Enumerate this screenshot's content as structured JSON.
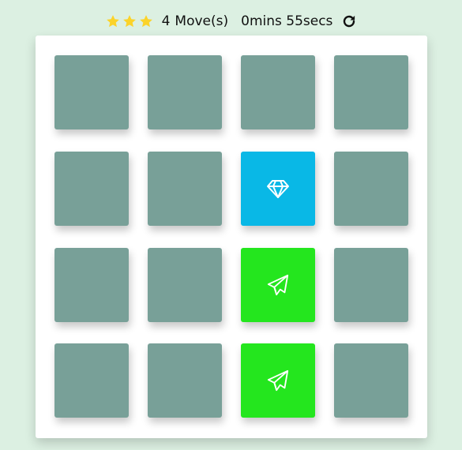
{
  "score_panel": {
    "stars": 3,
    "star_color": "#fbd32a",
    "moves_count": "4",
    "moves_label": "Move(s)",
    "time_text": "0mins 55secs",
    "restart_icon": "refresh-icon"
  },
  "colors": {
    "hidden": "#78a098",
    "open": "#09b8e6",
    "match": "#24e61e"
  },
  "board": {
    "rows": 4,
    "cols": 4,
    "cards": [
      {
        "state": "hidden",
        "icon": ""
      },
      {
        "state": "hidden",
        "icon": ""
      },
      {
        "state": "hidden",
        "icon": ""
      },
      {
        "state": "hidden",
        "icon": ""
      },
      {
        "state": "hidden",
        "icon": ""
      },
      {
        "state": "hidden",
        "icon": ""
      },
      {
        "state": "open",
        "icon": "diamond-icon"
      },
      {
        "state": "hidden",
        "icon": ""
      },
      {
        "state": "hidden",
        "icon": ""
      },
      {
        "state": "hidden",
        "icon": ""
      },
      {
        "state": "match",
        "icon": "paper-plane-icon"
      },
      {
        "state": "hidden",
        "icon": ""
      },
      {
        "state": "hidden",
        "icon": ""
      },
      {
        "state": "hidden",
        "icon": ""
      },
      {
        "state": "match",
        "icon": "paper-plane-icon"
      },
      {
        "state": "hidden",
        "icon": ""
      }
    ]
  }
}
